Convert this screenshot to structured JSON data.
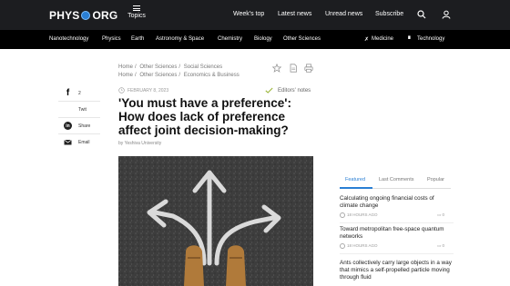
{
  "header": {
    "logo_left": "PHYS",
    "logo_right": "ORG",
    "topics_label": "Topics",
    "links": [
      "Week's top",
      "Latest news",
      "Unread news",
      "Subscribe"
    ]
  },
  "subnav": {
    "items": [
      "Nanotechnology",
      "Physics",
      "Earth",
      "Astronomy & Space",
      "Chemistry",
      "Biology",
      "Other Sciences"
    ],
    "right_items": [
      "Medicine",
      "Technology"
    ]
  },
  "share": {
    "facebook_count": "2",
    "twitter_label": "Twit",
    "linkedin_label": "Share",
    "email_label": "Email"
  },
  "breadcrumbs": [
    [
      "Home",
      "Other Sciences",
      "Social Sciences"
    ],
    [
      "Home",
      "Other Sciences",
      "Economics & Business"
    ]
  ],
  "article": {
    "date": "FEBRUARY 8, 2023",
    "editors_notes": "Editors' notes",
    "title": "'You must have a preference': How does lack of preference affect joint decision-making?",
    "author": "by Yeshiva University"
  },
  "sidebar": {
    "tabs": [
      "Featured",
      "Last Comments",
      "Popular"
    ],
    "items": [
      {
        "title": "Calculating ongoing financial costs of climate change",
        "time": "18 HOURS AGO",
        "comments": "0"
      },
      {
        "title": "Toward metropolitan free-space quantum networks",
        "time": "18 HOURS AGO",
        "comments": "0"
      },
      {
        "title": "Ants collectively carry large objects in a way that mimics a self-propelled particle moving through fluid",
        "time": "",
        "comments": ""
      }
    ]
  },
  "colors": {
    "accent": "#2a7fd4",
    "topbar": "#1c1d20",
    "subnav": "#000000"
  }
}
